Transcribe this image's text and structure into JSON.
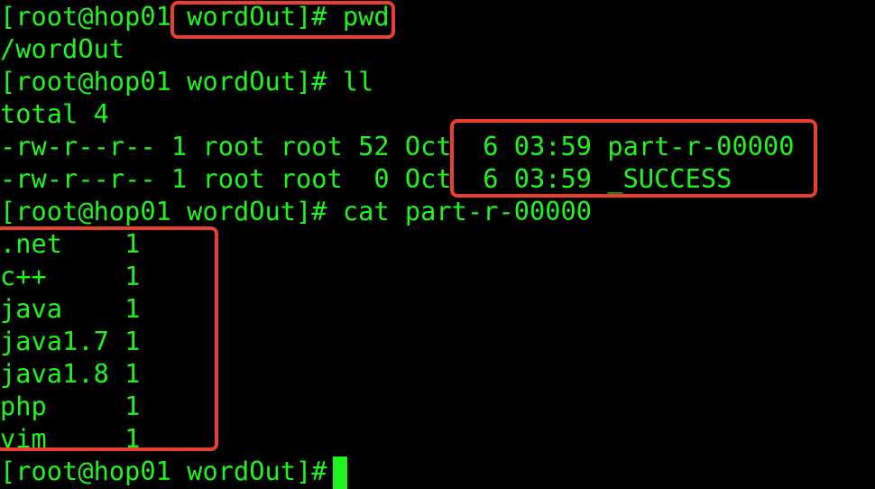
{
  "terminal": {
    "prompt": "[root@hop01 wordOut]# ",
    "foreground_color": "#1ef51e",
    "background_color": "#000000",
    "highlight_color": "#e8402c",
    "lines": [
      "[root@hop01 wordOut]# pwd",
      "/wordOut",
      "[root@hop01 wordOut]# ll",
      "total 4",
      "-rw-r--r-- 1 root root 52 Oct  6 03:59 part-r-00000",
      "-rw-r--r-- 1 root root  0 Oct  6 03:59 _SUCCESS",
      "[root@hop01 wordOut]# cat part-r-00000",
      ".net    1",
      "c++     1",
      "java    1",
      "java1.7 1",
      "java1.8 1",
      "php     1",
      "vim     1",
      "[root@hop01 wordOut]# "
    ],
    "highlights": [
      {
        "label": "pwd-command-highlight",
        "text": "wordOut]# pwd"
      },
      {
        "label": "file-list-highlight",
        "text": "6 03:59 part-r-00000 / 6 03:59 _SUCCESS"
      },
      {
        "label": "word-count-output-highlight",
        "text": ".net 1 ... vim 1"
      }
    ]
  }
}
